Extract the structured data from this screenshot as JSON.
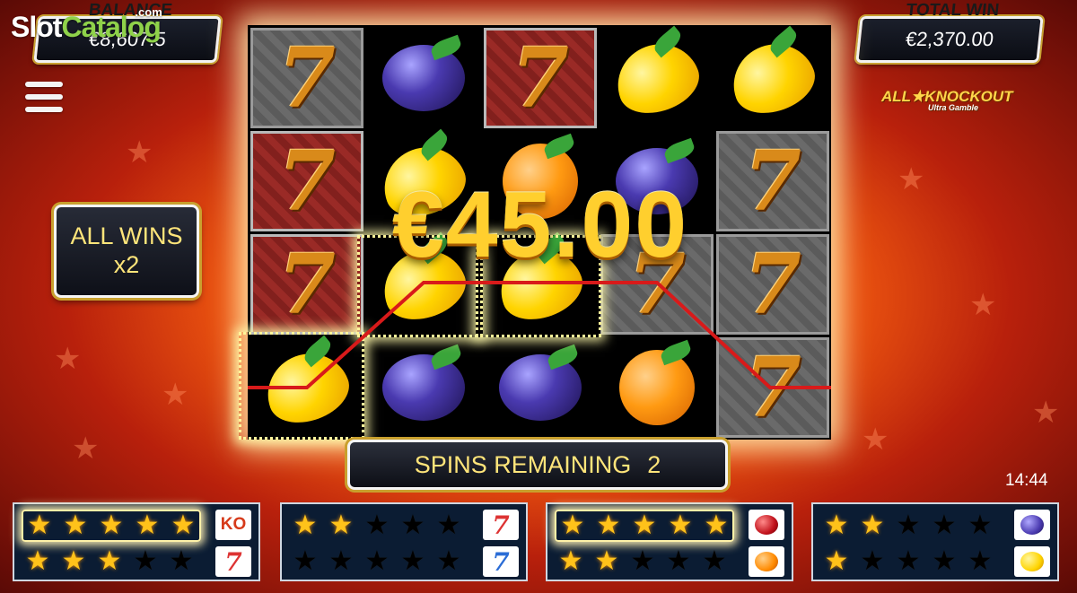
{
  "watermark": {
    "part1": "Slot",
    "part2": "Catalog",
    "suffix": ".com"
  },
  "hud": {
    "balance_label": "BALANCE",
    "balance_value": "€8,607.5",
    "total_win_label": "TOTAL WIN",
    "total_win_value": "€2,370.00"
  },
  "multiplier": {
    "line1": "ALL WINS",
    "line2": "x2"
  },
  "game_logo": {
    "title": "ALL★KNOCKOUT",
    "subtitle": "Ultra Gamble"
  },
  "win_amount": "€45.00",
  "spins": {
    "label": "SPINS REMAINING",
    "value": "2"
  },
  "clock": "14:44",
  "reels": [
    [
      "seven-grey",
      "plum",
      "seven-red",
      "lemon",
      "lemon"
    ],
    [
      "seven-red",
      "lemon",
      "orange",
      "plum",
      "seven-grey"
    ],
    [
      "seven-red",
      "lemon",
      "lemon",
      "seven-grey",
      "seven-grey"
    ],
    [
      "lemon",
      "plum",
      "plum",
      "orange",
      "seven-grey"
    ]
  ],
  "panels": [
    {
      "row1_lit": 5,
      "row2_lit": 3,
      "icon1": "KO",
      "icon2": "7"
    },
    {
      "row1_lit": 2,
      "row2_lit": 0,
      "icon1": "7",
      "icon2": "7"
    },
    {
      "row1_lit": 5,
      "row2_lit": 2,
      "icon1": "cherry",
      "icon2": "orange"
    },
    {
      "row1_lit": 2,
      "row2_lit": 1,
      "icon1": "plum",
      "icon2": "lemon"
    }
  ],
  "colors": {
    "accent_gold": "#ffcf2e",
    "payline": "#d81a1a"
  }
}
